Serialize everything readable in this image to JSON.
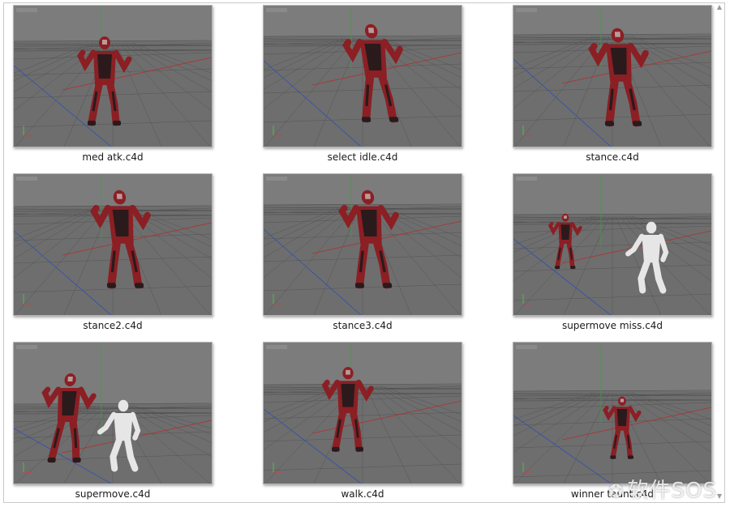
{
  "files": [
    {
      "name": "med atk.c4d"
    },
    {
      "name": "select idle.c4d"
    },
    {
      "name": "stance.c4d"
    },
    {
      "name": "stance2.c4d"
    },
    {
      "name": "stance3.c4d"
    },
    {
      "name": "supermove miss.c4d"
    },
    {
      "name": "supermove.c4d"
    },
    {
      "name": "walk.c4d"
    },
    {
      "name": "winner taunt.c4d"
    }
  ],
  "watermark": {
    "text": "软件SOS"
  },
  "colors": {
    "viewport_bg": "#6e6e6e",
    "figure_red": "#8b1f24",
    "figure_dark": "#2a1a1c",
    "dummy": "#e6e6e6"
  }
}
